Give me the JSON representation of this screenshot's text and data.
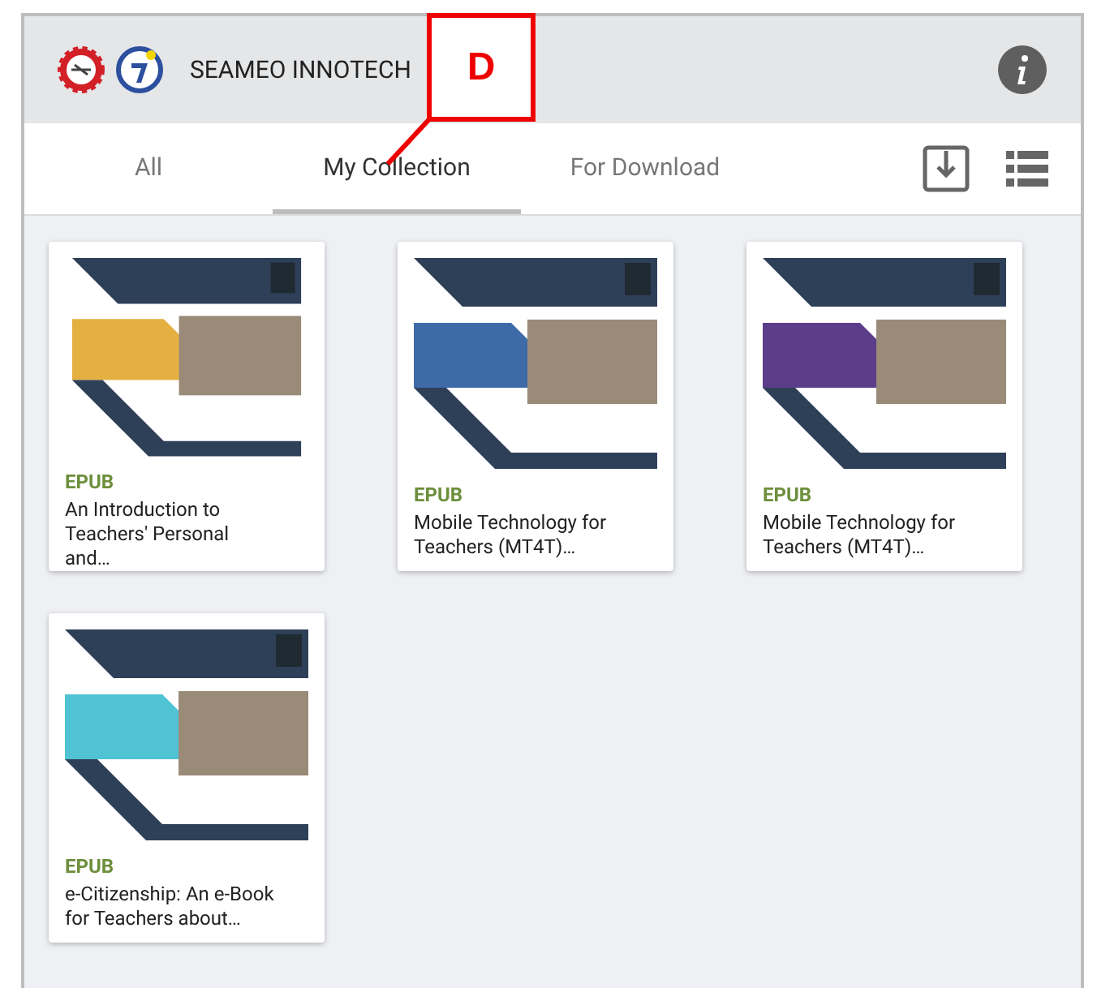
{
  "header": {
    "title": "SEAMEO INNOTECH"
  },
  "callout": {
    "label": "D"
  },
  "tabs": [
    {
      "label": "All",
      "selected": false
    },
    {
      "label": "My Collection",
      "selected": true
    },
    {
      "label": "For Download",
      "selected": false
    }
  ],
  "books": [
    {
      "format": "EPUB",
      "title": "An Introduction to Teachers' Personal and…",
      "color": "#e4b042"
    },
    {
      "format": "EPUB",
      "title": "Mobile Technology for Teachers (MT4T)…",
      "color": "#3e6aa8"
    },
    {
      "format": "EPUB",
      "title": "Mobile Technology for Teachers (MT4T)…",
      "color": "#5c3d8a"
    },
    {
      "format": "EPUB",
      "title": "e-Citizenship: An e-Book for Teachers about…",
      "color": "#4fc3d3"
    }
  ]
}
